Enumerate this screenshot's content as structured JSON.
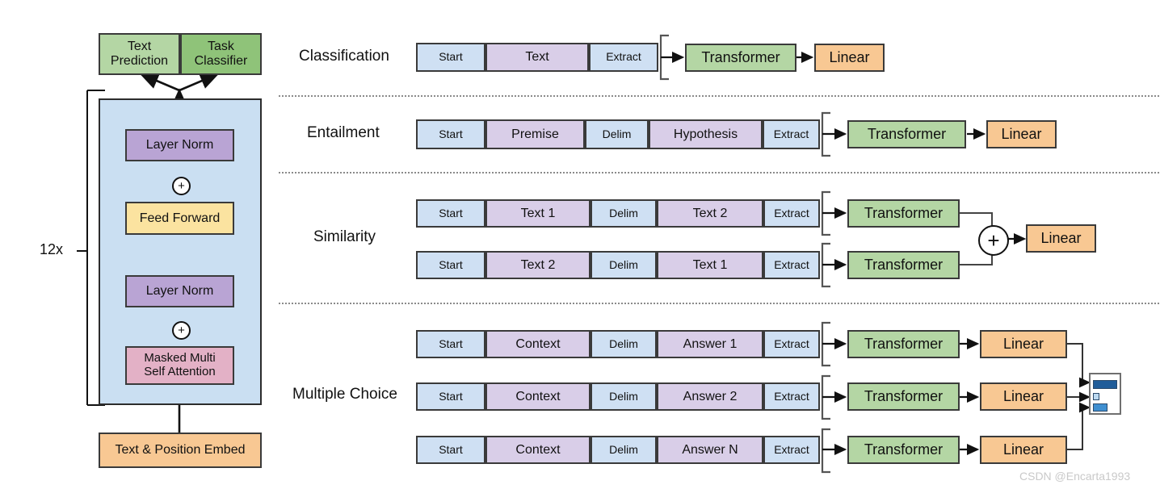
{
  "figure": {
    "watermark": "CSDN @Encarta1993",
    "colors": {
      "green_light": "#b4d6a4",
      "green_dark": "#8fc379",
      "blue_token": "#cfe0f3",
      "block_bg": "#cadff2",
      "purple": "#b9a4d4",
      "lilac_token": "#d9cee8",
      "yellow": "#fbe3a0",
      "pink": "#e3b1c6",
      "orange": "#f8c893",
      "separator": "#8a8a8a",
      "bar_dark": "#1f5c99",
      "bar_light": "#bcd9f0",
      "bar_mid": "#3f8fd0"
    }
  },
  "left_panel": {
    "heads": [
      {
        "label": "Text\nPrediction",
        "line1": "Text",
        "line2": "Prediction",
        "color": "green_light"
      },
      {
        "label": "Task\nClassifier",
        "line1": "Task",
        "line2": "Classifier",
        "color": "green_dark"
      }
    ],
    "repeat_label": "12x",
    "block_layers": [
      {
        "label": "Layer Norm",
        "color": "purple"
      },
      {
        "label": "Feed Forward",
        "color": "yellow"
      },
      {
        "label": "Layer Norm",
        "color": "purple"
      },
      {
        "line1": "Masked Multi",
        "line2": "Self Attention",
        "label": "Masked Multi Self Attention",
        "color": "pink"
      }
    ],
    "embed": {
      "label": "Text & Position Embed",
      "color": "orange"
    },
    "residual_symbol": "+"
  },
  "tasks": [
    {
      "name": "Classification",
      "sequences": [
        {
          "tokens": [
            {
              "text": "Start",
              "kind": "special"
            },
            {
              "text": "Text",
              "kind": "content"
            },
            {
              "text": "Extract",
              "kind": "special"
            }
          ]
        }
      ],
      "transformers": [
        "Transformer"
      ],
      "linear": "Linear",
      "combiner": null
    },
    {
      "name": "Entailment",
      "sequences": [
        {
          "tokens": [
            {
              "text": "Start",
              "kind": "special"
            },
            {
              "text": "Premise",
              "kind": "content"
            },
            {
              "text": "Delim",
              "kind": "special"
            },
            {
              "text": "Hypothesis",
              "kind": "content"
            },
            {
              "text": "Extract",
              "kind": "special"
            }
          ]
        }
      ],
      "transformers": [
        "Transformer"
      ],
      "linear": "Linear",
      "combiner": null
    },
    {
      "name": "Similarity",
      "sequences": [
        {
          "tokens": [
            {
              "text": "Start",
              "kind": "special"
            },
            {
              "text": "Text 1",
              "kind": "content"
            },
            {
              "text": "Delim",
              "kind": "special"
            },
            {
              "text": "Text 2",
              "kind": "content"
            },
            {
              "text": "Extract",
              "kind": "special"
            }
          ]
        },
        {
          "tokens": [
            {
              "text": "Start",
              "kind": "special"
            },
            {
              "text": "Text 2",
              "kind": "content"
            },
            {
              "text": "Delim",
              "kind": "special"
            },
            {
              "text": "Text 1",
              "kind": "content"
            },
            {
              "text": "Extract",
              "kind": "special"
            }
          ]
        }
      ],
      "transformers": [
        "Transformer",
        "Transformer"
      ],
      "linear": "Linear",
      "combiner": "+"
    },
    {
      "name": "Multiple Choice",
      "sequences": [
        {
          "tokens": [
            {
              "text": "Start",
              "kind": "special"
            },
            {
              "text": "Context",
              "kind": "content"
            },
            {
              "text": "Delim",
              "kind": "special"
            },
            {
              "text": "Answer 1",
              "kind": "content"
            },
            {
              "text": "Extract",
              "kind": "special"
            }
          ]
        },
        {
          "tokens": [
            {
              "text": "Start",
              "kind": "special"
            },
            {
              "text": "Context",
              "kind": "content"
            },
            {
              "text": "Delim",
              "kind": "special"
            },
            {
              "text": "Answer 2",
              "kind": "content"
            },
            {
              "text": "Extract",
              "kind": "special"
            }
          ]
        },
        {
          "tokens": [
            {
              "text": "Start",
              "kind": "special"
            },
            {
              "text": "Context",
              "kind": "content"
            },
            {
              "text": "Delim",
              "kind": "special"
            },
            {
              "text": "Answer N",
              "kind": "content"
            },
            {
              "text": "Extract",
              "kind": "special"
            }
          ]
        }
      ],
      "transformers": [
        "Transformer",
        "Transformer",
        "Transformer"
      ],
      "linears": [
        "Linear",
        "Linear",
        "Linear"
      ],
      "combiner": null,
      "output_chart": {
        "type": "bar",
        "orientation": "horizontal",
        "values": [
          1.0,
          0.18,
          0.55
        ],
        "colors": [
          "bar_dark",
          "bar_light",
          "bar_mid"
        ]
      }
    }
  ],
  "labels": {
    "text_prediction_l1": "Text",
    "text_prediction_l2": "Prediction",
    "task_classifier_l1": "Task",
    "task_classifier_l2": "Classifier",
    "layer_norm": "Layer Norm",
    "feed_forward": "Feed Forward",
    "masked_l1": "Masked Multi",
    "masked_l2": "Self Attention",
    "embed": "Text & Position Embed",
    "repeat": "12x",
    "plus": "+",
    "classification": "Classification",
    "entailment": "Entailment",
    "similarity": "Similarity",
    "multiple_choice": "Multiple Choice",
    "transformer": "Transformer",
    "linear": "Linear",
    "start": "Start",
    "text": "Text",
    "extract": "Extract",
    "premise": "Premise",
    "delim": "Delim",
    "hypothesis": "Hypothesis",
    "text1": "Text 1",
    "text2": "Text 2",
    "context": "Context",
    "answer1": "Answer 1",
    "answer2": "Answer 2",
    "answerN": "Answer N"
  }
}
